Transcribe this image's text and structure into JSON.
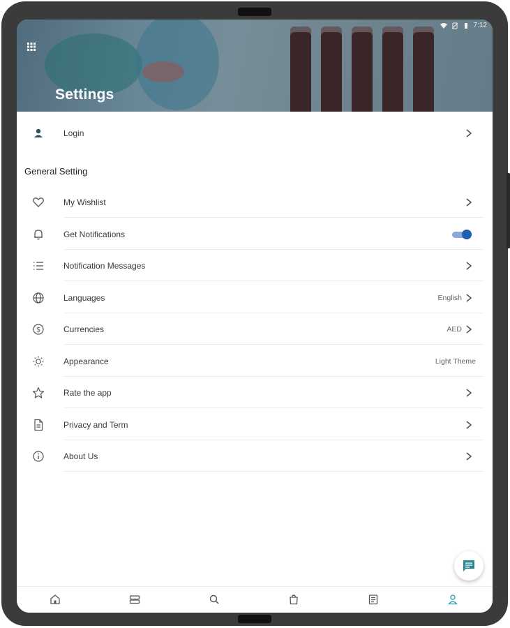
{
  "status_bar": {
    "time": "7:12"
  },
  "header": {
    "title": "Settings"
  },
  "login": {
    "label": "Login"
  },
  "section": {
    "title": "General Setting"
  },
  "items": [
    {
      "label": "My Wishlist",
      "icon": "heart-icon"
    },
    {
      "label": "Get Notifications",
      "icon": "bell-icon",
      "toggle_on": true
    },
    {
      "label": "Notification Messages",
      "icon": "list-icon"
    },
    {
      "label": "Languages",
      "icon": "globe-icon",
      "value": "English"
    },
    {
      "label": "Currencies",
      "icon": "currency-icon",
      "value": "AED"
    },
    {
      "label": "Appearance",
      "icon": "sun-icon",
      "value": "Light Theme"
    },
    {
      "label": "Rate the app",
      "icon": "star-icon"
    },
    {
      "label": "Privacy and Term",
      "icon": "document-icon"
    },
    {
      "label": "About Us",
      "icon": "info-icon"
    }
  ],
  "bottom_nav": [
    "home-icon",
    "categories-icon",
    "search-icon",
    "cart-icon",
    "orders-icon",
    "profile-icon"
  ],
  "colors": {
    "accent": "#1e5fb4",
    "teal": "#2a8a93",
    "icon_gray": "#555555",
    "active_nav": "#2a9ba3"
  }
}
